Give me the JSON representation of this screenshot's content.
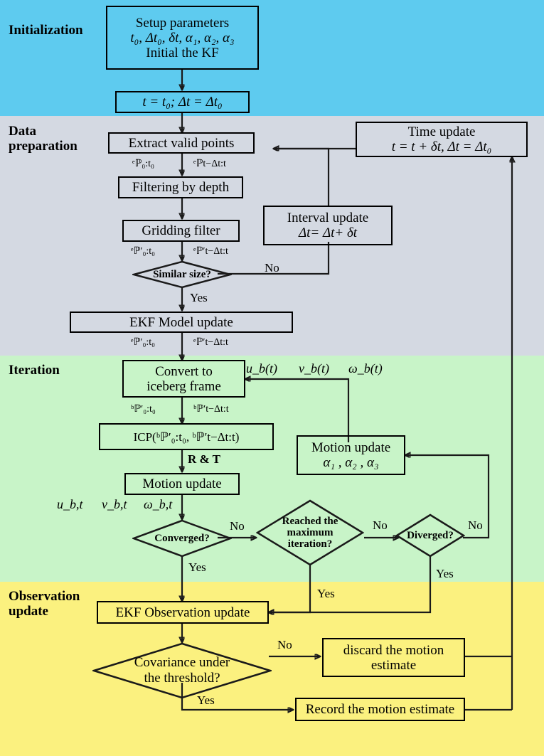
{
  "title": "Iceberg motion estimation algorithm flowchart",
  "bands": [
    {
      "id": "initialization",
      "label": "Initialization",
      "color": "#5ecbef"
    },
    {
      "id": "data-preparation",
      "label": "Data\npreparation",
      "color": "#d4d9e2"
    },
    {
      "id": "iteration",
      "label": "Iteration",
      "color": "#c8f4c8"
    },
    {
      "id": "observation-update",
      "label": "Observation\nupdate",
      "color": "#fbf17f"
    }
  ],
  "band_labels": {
    "initialization": "Initialization",
    "data_preparation_l1": "Data",
    "data_preparation_l2": "preparation",
    "iteration": "Iteration",
    "observation_l1": "Observation",
    "observation_l2": "update"
  },
  "nodes": {
    "setup_l1": "Setup parameters",
    "setup_l2": "t₀, Δt₀, δt, α₁, α₂, α₃",
    "setup_l3": "Initial the KF",
    "init_assign": "t = t₀;  Δt = Δt₀",
    "extract_valid_points": "Extract valid points",
    "filtering_by_depth": "Filtering by depth",
    "gridding_filter": "Gridding filter",
    "ekf_model_update": "EKF Model update",
    "time_update_l1": "Time update",
    "time_update_l2": "t = t + δt, Δt = Δt₀",
    "interval_update_l1": "Interval update",
    "interval_update_l2": "Δt= Δt+ δt",
    "convert_l1": "Convert to",
    "convert_l2": "iceberg frame",
    "icp": "ICP(ᵇℙ′₀:t₀,      ᵇℙ′t−Δt:t)",
    "motion_update": "Motion update",
    "motion_update_params_l1": "Motion update",
    "motion_update_params_l2": "α₁ , α₂ , α₃",
    "ekf_observation_update": "EKF Observation update",
    "discard_l1": "discard the motion",
    "discard_l2": "estimate",
    "record": "Record the motion estimate"
  },
  "decisions": {
    "similar_size": "Similar size?",
    "converged": "Converged?",
    "reached_max_l1": "Reached the",
    "reached_max_l2": "maximum",
    "reached_max_l3": "iteration?",
    "diverged": "Diverged?",
    "covariance_l1": "Covariance under",
    "covariance_l2": "the threshold?"
  },
  "edge_labels": {
    "similar_size_no": "No",
    "similar_size_yes": "Yes",
    "converged_no": "No",
    "converged_yes": "Yes",
    "reached_max_no": "No",
    "reached_max_yes": "Yes",
    "diverged_no": "No",
    "diverged_yes": "Yes",
    "covariance_no": "No",
    "covariance_yes": "Yes",
    "r_and_t": "R & T"
  },
  "signal_labels": {
    "p_0t0": "ᵉℙ₀:t₀",
    "p_tdt": "ᵉℙt−Δt:t",
    "pp_0t0": "ᵉℙ′₀:t₀",
    "pp_tdt": "ᵉℙ′t−Δt:t",
    "pp_0t0_b": "ᵇℙ′₀:t₀",
    "pp_tdt_b": "ᵇℙ′t−Δt:t",
    "ub_t": "u_b(t)",
    "vb_t": "v_b(t)",
    "wb_t": "ω_b(t)",
    "ub_bt": "u_b,t",
    "vb_bt": "v_b,t",
    "wb_bt": "ω_b,t"
  },
  "colors": {
    "band_initialization": "#5ecbef",
    "band_data_preparation": "#d4d9e2",
    "band_iteration": "#c8f4c8",
    "band_observation": "#fbf17f",
    "stroke": "#1a1a1a"
  }
}
